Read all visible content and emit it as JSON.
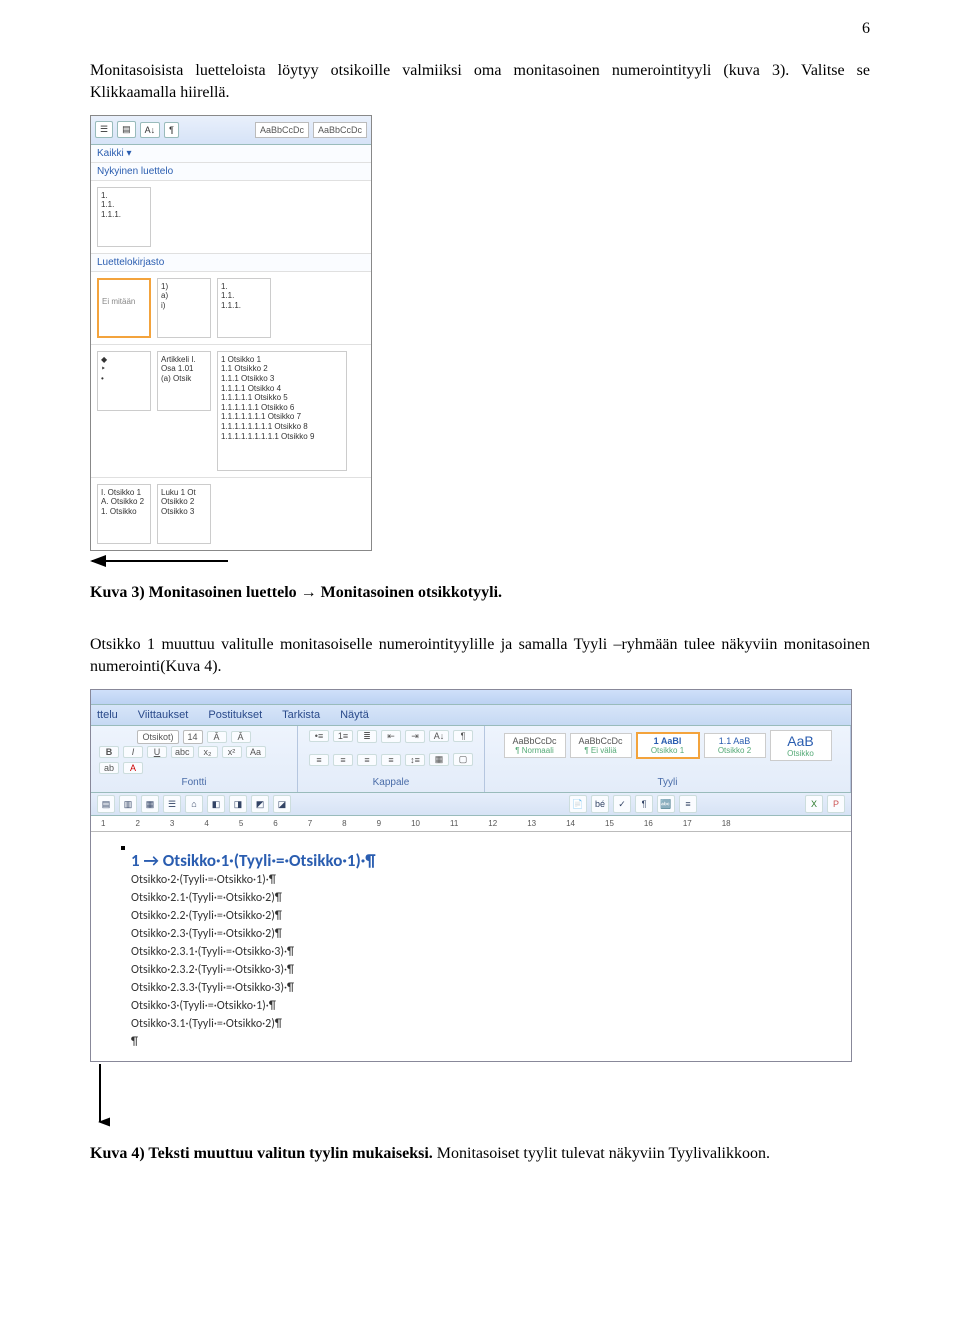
{
  "page_number": "6",
  "para1": "Monitasoisista luetteloista löytyy otsikoille valmiiksi oma monitasoinen numerointityyli (kuva 3). Valitse se Klikkaamalla hiirellä.",
  "caption1_label": "Kuva 3) Monitasoinen luettelo → Monitasoinen otsikkotyyli.",
  "para2": "Otsikko 1 muuttuu valitulle monitasoiselle numerointityylille ja samalla Tyyli –ryhmään tulee näkyviin monitasoinen numerointi(Kuva 4).",
  "caption2_label": "Kuva 4) Teksti muuttuu valitun tyylin mukaiseksi.",
  "caption2_tail": " Monitasoiset tyylit tulevat näkyviin Tyylivalikkoon.",
  "fig1": {
    "ribbon_styles": [
      "AaBbCcDc",
      "AaBbCcDc"
    ],
    "head_kaikki": "Kaikki",
    "head_nykyinen": "Nykyinen luettelo",
    "head_kirjasto": "Luettelokirjasto",
    "current_thumb": [
      "1.",
      "1.1.",
      "1.1.1."
    ],
    "none_label": "Ei mitään",
    "lib_row1": {
      "c2": [
        "1)",
        "a)",
        "i)"
      ],
      "c3": [
        "1.",
        "1.1.",
        "1.1.1."
      ]
    },
    "lib_row2": {
      "c1": [
        "◆",
        "‣",
        "•"
      ],
      "c2": [
        "Artikkeli I.",
        "Osa 1.01",
        "(a) Otsik"
      ],
      "c3": [
        "1 Otsikko 1",
        "1.1 Otsikko 2",
        "1.1.1 Otsikko 3",
        "1.1.1.1 Otsikko 4",
        "1.1.1.1.1 Otsikko 5",
        "1.1.1.1.1.1 Otsikko 6",
        "1.1.1.1.1.1.1 Otsikko 7",
        "1.1.1.1.1.1.1.1 Otsikko 8",
        "1.1.1.1.1.1.1.1.1 Otsikko 9"
      ]
    },
    "lib_row3": {
      "c1": [
        "I. Otsikko 1",
        "A. Otsikko 2",
        "1. Otsikko"
      ],
      "c2": [
        "Luku 1 Ot",
        "Otsikko 2",
        "Otsikko 3"
      ]
    }
  },
  "fig2": {
    "tabs": [
      "ttelu",
      "Viittaukset",
      "Postitukset",
      "Tarkista",
      "Näytä"
    ],
    "font_group": {
      "name_box": "Otsikot)",
      "size_box": "14",
      "label": "Fontti"
    },
    "para_group": {
      "label": "Kappale"
    },
    "style_group": {
      "label": "Tyyli",
      "boxes": [
        {
          "preview": "AaBbCcDc",
          "name": "¶ Normaali",
          "sel": false
        },
        {
          "preview": "AaBbCcDc",
          "name": "¶ Ei väliä",
          "sel": false
        },
        {
          "preview": "1 AaBl",
          "name": "Otsikko 1",
          "sel": true
        },
        {
          "preview": "1.1 AaB",
          "name": "Otsikko 2",
          "sel": false
        },
        {
          "preview": "AaB",
          "name": "Otsikko",
          "sel": false
        }
      ]
    },
    "ruler_marks": [
      "1",
      "2",
      "3",
      "4",
      "5",
      "6",
      "7",
      "8",
      "9",
      "10",
      "11",
      "12",
      "13",
      "14",
      "15",
      "16",
      "17",
      "18"
    ],
    "doc_lines": [
      "1 → Otsikko·1·(Tyyli·=·Otsikko·1)·¶",
      "Otsikko·2·(Tyyli·=·Otsikko·1)·¶",
      "Otsikko·2.1·(Tyyli·=·Otsikko·2)¶",
      "Otsikko·2.2·(Tyyli·=·Otsikko·2)¶",
      "Otsikko·2.3·(Tyyli·=·Otsikko·2)¶",
      "Otsikko·2.3.1·(Tyyli·=·Otsikko·3)·¶",
      "Otsikko·2.3.2·(Tyyli·=·Otsikko·3)·¶",
      "Otsikko·2.3.3·(Tyyli·=·Otsikko·3)·¶",
      "Otsikko·3·(Tyyli·=·Otsikko·1)·¶",
      "Otsikko·3.1·(Tyyli·=·Otsikko·2)¶",
      "¶"
    ]
  }
}
